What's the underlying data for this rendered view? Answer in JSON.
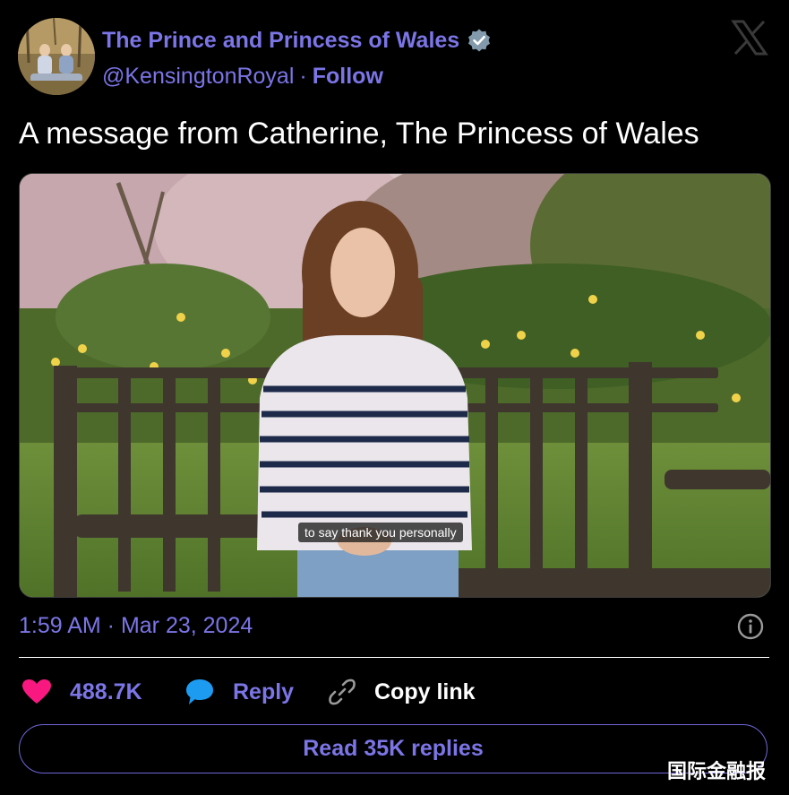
{
  "header": {
    "display_name": "The Prince and Princess of Wales",
    "handle": "@KensingtonRoyal",
    "separator": "·",
    "follow_label": "Follow",
    "verified_icon": "verified-badge-icon",
    "platform_logo": "x-logo-icon"
  },
  "tweet": {
    "text": "A message from Catherine, The Princess of Wales",
    "video_caption": "to say thank you personally",
    "timestamp": "1:59 AM · Mar 23, 2024"
  },
  "actions": {
    "like_count": "488.7K",
    "reply_label": "Reply",
    "copy_link_label": "Copy link",
    "read_replies_label": "Read 35K replies"
  },
  "watermark": "国际金融报",
  "colors": {
    "background": "#000000",
    "accent": "#7b75e6",
    "text": "#ffffff",
    "like": "#f91880",
    "reply": "#1d9bf0"
  }
}
